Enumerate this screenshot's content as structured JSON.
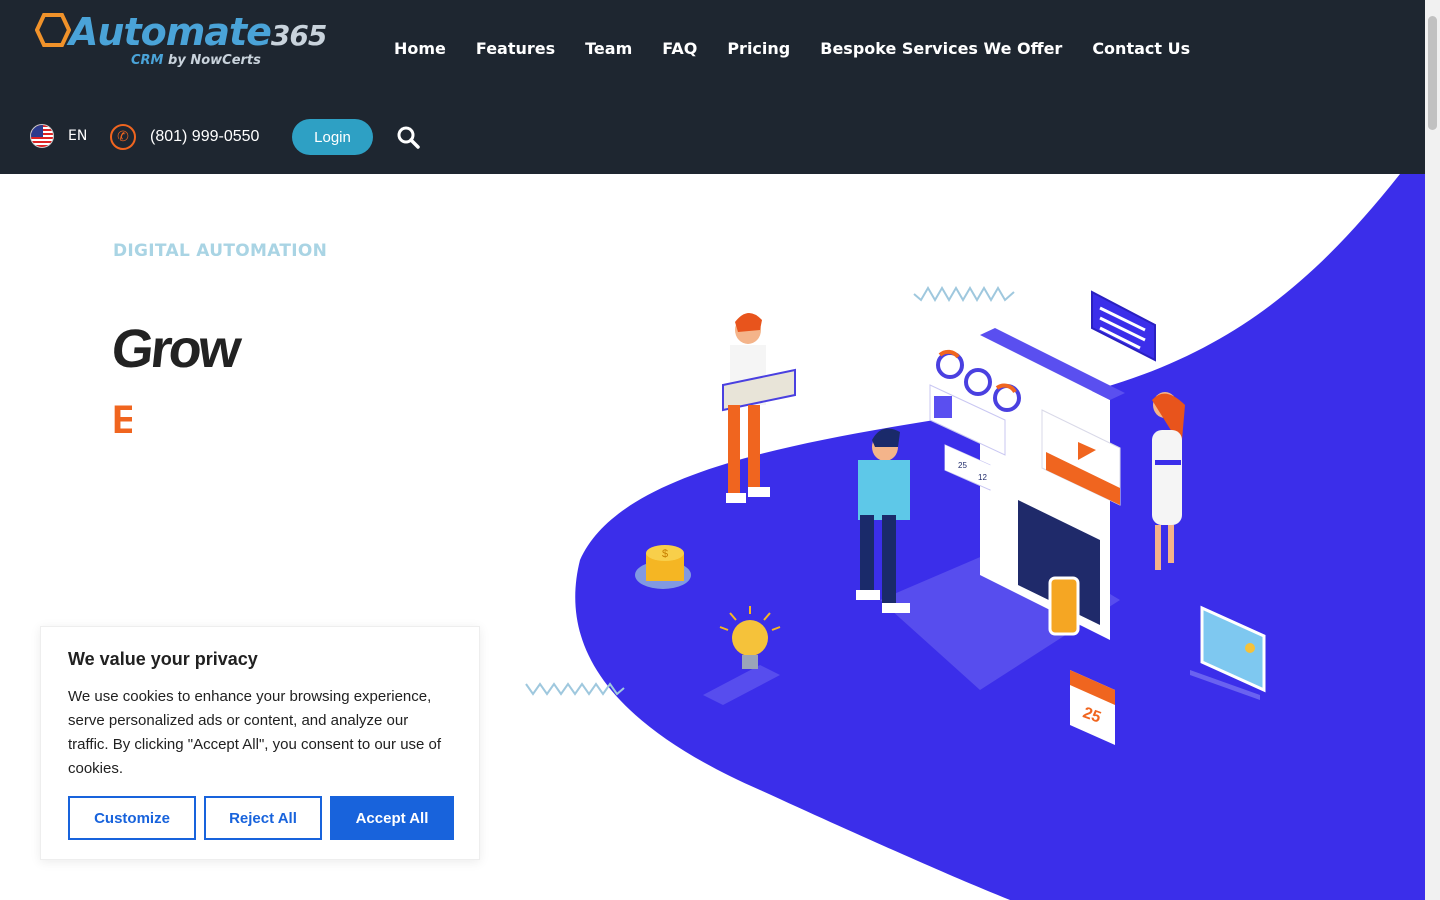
{
  "header": {
    "logo_text": "Automate",
    "logo_num": "365",
    "logo_sub_crm": "CRM",
    "logo_sub_rest": " by NowCerts",
    "nav": [
      "Home",
      "Features",
      "Team",
      "FAQ",
      "Pricing",
      "Bespoke Services We Offer",
      "Contact Us"
    ],
    "lang": "EN",
    "phone": "(801) 999-0550",
    "login": "Login"
  },
  "hero": {
    "eyebrow": "DIGITAL AUTOMATION",
    "headline": "Grow",
    "headline_2": "E"
  },
  "cookie": {
    "title": "We value your privacy",
    "body": "We use cookies to enhance your browsing experience, serve personalized ads or content, and analyze our traffic. By clicking \"Accept All\", you consent to our use of cookies.",
    "customize": "Customize",
    "reject": "Reject All",
    "accept": "Accept All"
  },
  "illustration": {
    "calendar_day": "25",
    "coin_symbol": "$",
    "likes": "25",
    "comments": "12"
  },
  "colors": {
    "header_bg": "#1e2630",
    "accent_blue": "#3b2eea",
    "login_bg": "#2ea0c4",
    "orange": "#f0651f",
    "cookie_primary": "#1863dc"
  }
}
